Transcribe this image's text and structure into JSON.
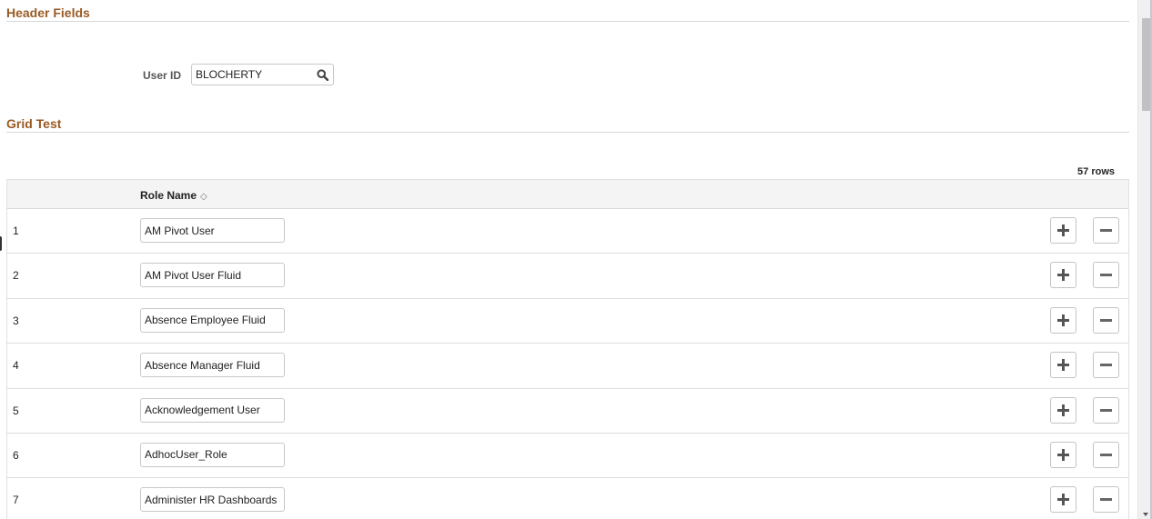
{
  "sections": {
    "header_fields": {
      "title": "Header Fields"
    },
    "grid_test": {
      "title": "Grid Test"
    }
  },
  "user_id": {
    "label": "User ID",
    "value": "BLOCHERTY",
    "lookup_icon": "search-icon"
  },
  "grid": {
    "row_count": "57 rows",
    "columns": [
      {
        "label": "Role Name",
        "sort_icon": "sort-updown-icon"
      }
    ],
    "rows": [
      {
        "num": "1",
        "role_name": "AM Pivot User"
      },
      {
        "num": "2",
        "role_name": "AM Pivot User Fluid"
      },
      {
        "num": "3",
        "role_name": "Absence Employee Fluid"
      },
      {
        "num": "4",
        "role_name": "Absence Manager Fluid"
      },
      {
        "num": "5",
        "role_name": "Acknowledgement User"
      },
      {
        "num": "6",
        "role_name": "AdhocUser_Role"
      },
      {
        "num": "7",
        "role_name": "Administer HR Dashboards"
      }
    ],
    "add_icon": "plus-icon",
    "delete_icon": "minus-icon"
  },
  "colors": {
    "section_title": "#9a5a24",
    "header_bg": "#f4f4f4"
  }
}
